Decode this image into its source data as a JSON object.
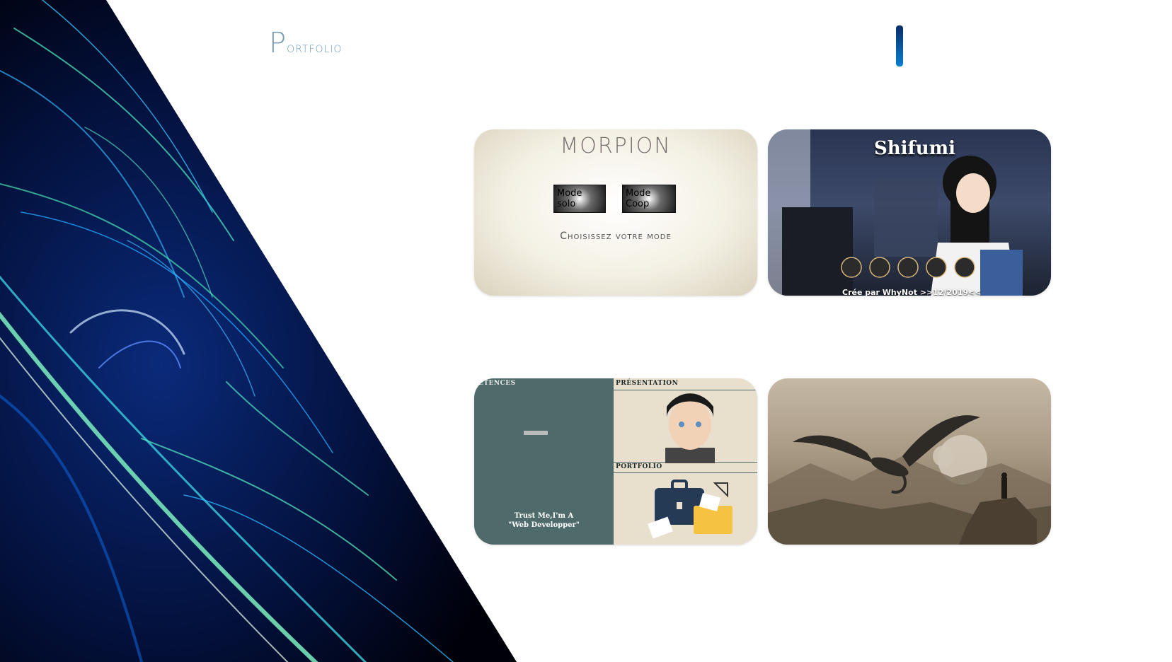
{
  "header": {
    "logo_cap": "P",
    "logo_rest": "ortfolio"
  },
  "cards": {
    "morpion": {
      "title": "MORPION",
      "solo_label": "Mode solo",
      "coop_label": "Mode Coop",
      "subtitle": "Choisissez votre mode"
    },
    "shifumi": {
      "title": "Shifumi",
      "credit": "Crée par WhyNot >>12/2019<<"
    },
    "cv": {
      "left_heading": "ÉTENCES",
      "presentation_heading": "PRÉSENTATION",
      "portfolio_heading": "PORTFOLIO",
      "tagline_line1": "Trust Me,I'm A",
      "tagline_line2": "\"Web Developper\""
    }
  },
  "colors": {
    "accent": "#0b5fa8",
    "cv_panel": "#4e6a6a",
    "logo": "#6a9ab8"
  }
}
